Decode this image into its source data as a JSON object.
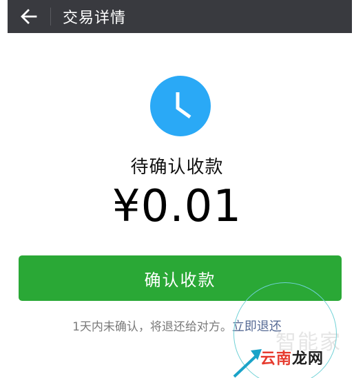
{
  "header": {
    "title": "交易详情",
    "back_icon": "arrow-left-icon"
  },
  "status": {
    "icon": "clock-icon",
    "icon_color": "#2aa9f6",
    "text": "待确认收款"
  },
  "amount": "¥0.01",
  "confirm_button": {
    "label": "确认收款",
    "color": "#2aa836"
  },
  "notice": {
    "text": "1天内未确认，将退还给对方。",
    "link": "立即退还"
  },
  "watermark": {
    "part1": "云南",
    "part2": "龙网",
    "ghost": "智能家"
  }
}
